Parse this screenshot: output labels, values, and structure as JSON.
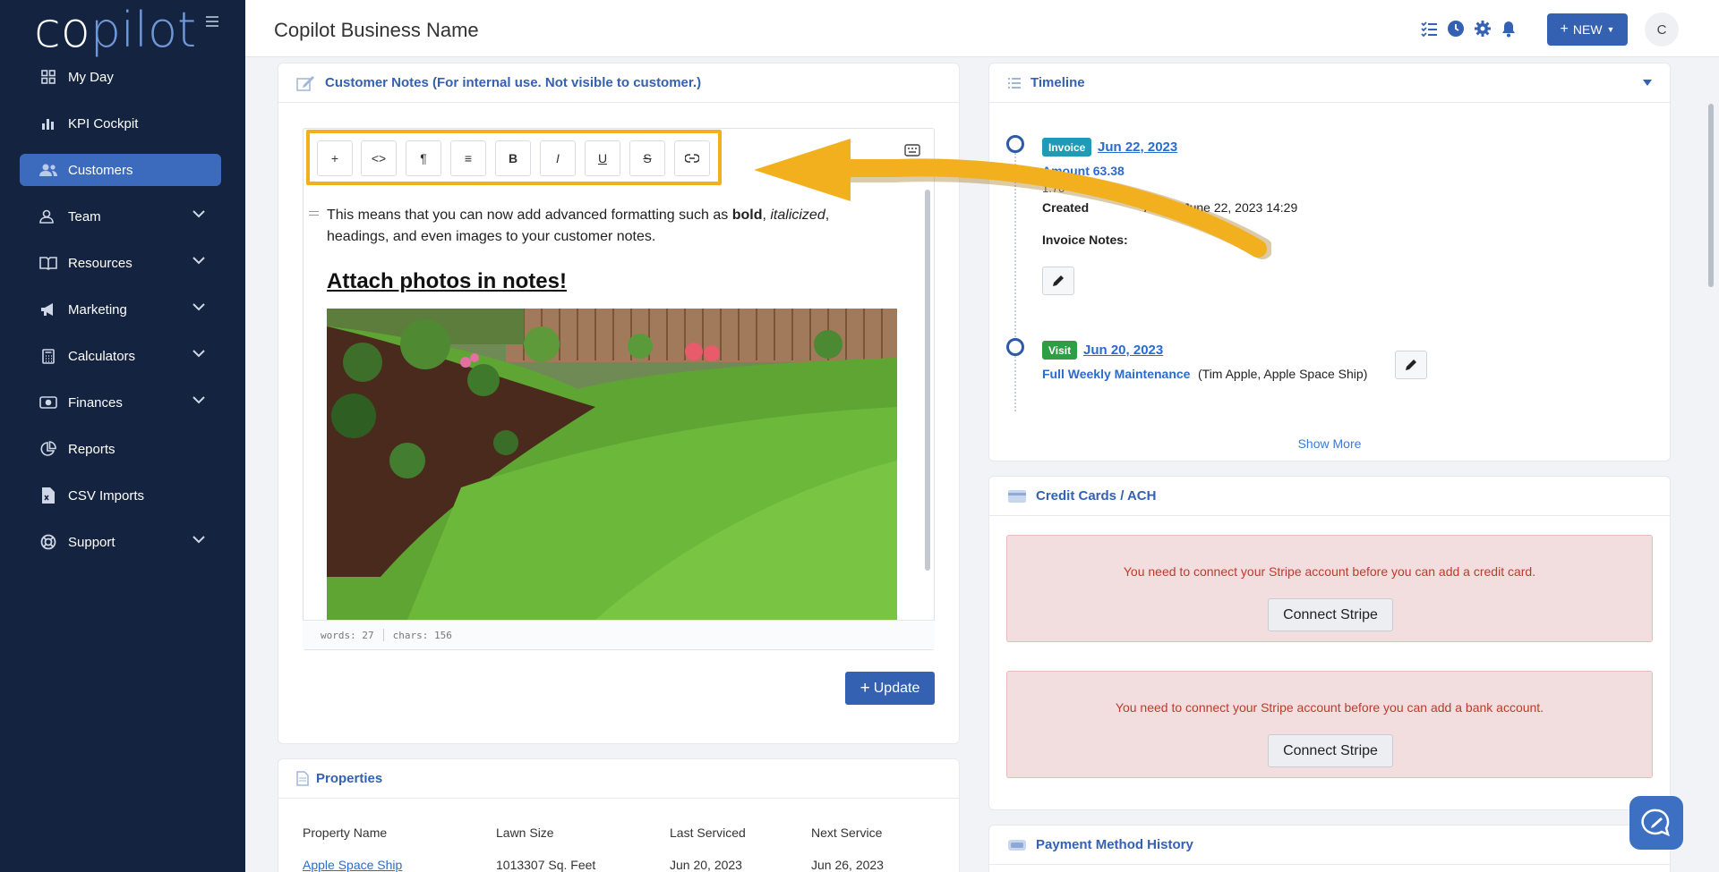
{
  "app": {
    "logo_text_1": "co",
    "logo_text_2": "pilot",
    "business_name": "Copilot Business Name",
    "new_button": "NEW",
    "avatar_initial": "C"
  },
  "sidebar": {
    "items": [
      {
        "label": "My Day",
        "icon": "grid-icon",
        "expandable": false,
        "active": false
      },
      {
        "label": "KPI Cockpit",
        "icon": "bar-chart-icon",
        "expandable": false,
        "active": false
      },
      {
        "label": "Customers",
        "icon": "users-icon",
        "expandable": false,
        "active": true
      },
      {
        "label": "Team",
        "icon": "person-icon",
        "expandable": true,
        "active": false
      },
      {
        "label": "Resources",
        "icon": "book-icon",
        "expandable": true,
        "active": false
      },
      {
        "label": "Marketing",
        "icon": "megaphone-icon",
        "expandable": true,
        "active": false
      },
      {
        "label": "Calculators",
        "icon": "calculator-icon",
        "expandable": true,
        "active": false
      },
      {
        "label": "Finances",
        "icon": "money-icon",
        "expandable": true,
        "active": false
      },
      {
        "label": "Reports",
        "icon": "pie-chart-icon",
        "expandable": false,
        "active": false
      },
      {
        "label": "CSV Imports",
        "icon": "file-csv-icon",
        "expandable": false,
        "active": false
      },
      {
        "label": "Support",
        "icon": "lifebuoy-icon",
        "expandable": true,
        "active": false
      }
    ]
  },
  "notes": {
    "title": "Customer Notes (For internal use. Not visible to customer.)",
    "toolbar": [
      "+",
      "<>",
      "¶",
      "≡",
      "B",
      "I",
      "U",
      "S",
      "link"
    ],
    "body_prefix": "This means that you can now add advanced formatting such as ",
    "body_bold": "bold",
    "body_comma": ", ",
    "body_italic": "italicized",
    "body_suffix": ", headings, and even images to your customer notes.",
    "heading": "Attach photos in notes!",
    "words": "words: 27",
    "chars": "chars: 156",
    "update_button": "Update"
  },
  "properties": {
    "title": "Properties",
    "columns": [
      "Property Name",
      "Lawn Size",
      "Last Serviced",
      "Next Service"
    ],
    "rows": [
      {
        "name": "Apple Space Ship",
        "size": "1013307 Sq. Feet",
        "last": "Jun 20, 2023",
        "next": "Jun 26, 2023"
      }
    ]
  },
  "timeline": {
    "title": "Timeline",
    "entries": [
      {
        "badge": "Invoice",
        "badge_color": "#1f9bb5",
        "date": "Jun 22, 2023",
        "amount": "Amount 63.38",
        "partial": "1.70",
        "created_prefix": "Created",
        "created_suffix": "Andes June 22, 2023 14:29",
        "notes_label": "Invoice Notes:"
      },
      {
        "badge": "Visit",
        "badge_color": "#2e9e44",
        "date": "Jun 20, 2023",
        "service": "Full Weekly Maintenance",
        "detail": "(Tim Apple, Apple Space Ship)"
      }
    ],
    "show_more": "Show More"
  },
  "credit_cards": {
    "title": "Credit Cards / ACH",
    "alerts": [
      {
        "text": "You need to connect your Stripe account before you can add a credit card.",
        "button": "Connect Stripe"
      },
      {
        "text": "You need to connect your Stripe account before you can add a bank account.",
        "button": "Connect Stripe"
      }
    ]
  },
  "payment_history": {
    "title": "Payment Method History"
  },
  "colors": {
    "sidebar_bg": "#14233f",
    "accent": "#3461b1",
    "highlight": "#f2b01e",
    "alert_bg": "#f2dede"
  }
}
